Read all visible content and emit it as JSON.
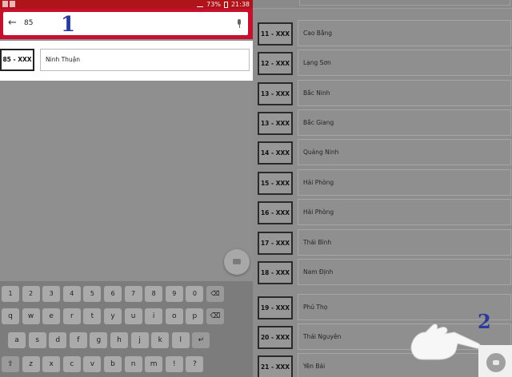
{
  "statusbar": {
    "battery": "73%",
    "time": "21:38"
  },
  "search": {
    "value": "85",
    "back_glyph": "←"
  },
  "annotations": {
    "step_one": "1",
    "step_two": "2"
  },
  "result": {
    "plate": "85 - XXX",
    "province": "Ninh Thuận"
  },
  "keyboard": {
    "rows": [
      [
        "1",
        "2",
        "3",
        "4",
        "5",
        "6",
        "7",
        "8",
        "9",
        "0",
        "⌫"
      ],
      [
        "q",
        "w",
        "e",
        "r",
        "t",
        "y",
        "u",
        "i",
        "o",
        "p",
        "⌫"
      ],
      [
        "a",
        "s",
        "d",
        "f",
        "g",
        "h",
        "j",
        "k",
        "l",
        "↵"
      ],
      [
        "⇧",
        "z",
        "x",
        "c",
        "v",
        "b",
        "n",
        "m",
        "!",
        "?"
      ]
    ]
  },
  "plates": [
    {
      "plate": "11 - XXX",
      "province": "Cao Bằng"
    },
    {
      "plate": "12 - XXX",
      "province": "Lạng Sơn"
    },
    {
      "plate": "13 - XXX",
      "province": "Bắc Ninh"
    },
    {
      "plate": "13 - XXX",
      "province": "Bắc Giang"
    },
    {
      "plate": "14 - XXX",
      "province": "Quảng Ninh"
    },
    {
      "plate": "15 - XXX",
      "province": "Hải Phòng"
    },
    {
      "plate": "16 - XXX",
      "province": "Hải Phòng"
    },
    {
      "plate": "17 - XXX",
      "province": "Thái Bình"
    },
    {
      "plate": "18 - XXX",
      "province": "Nam Định"
    },
    {
      "plate": "19 - XXX",
      "province": "Phú Thọ"
    },
    {
      "plate": "20 - XXX",
      "province": "Thái Nguyên"
    },
    {
      "plate": "21 - XXX",
      "province": "Yên Bái"
    }
  ],
  "colors": {
    "toolbar_red": "#c8102e",
    "annotation_blue": "#2a3a9c",
    "overlay_gray": "#8d8d8d"
  }
}
